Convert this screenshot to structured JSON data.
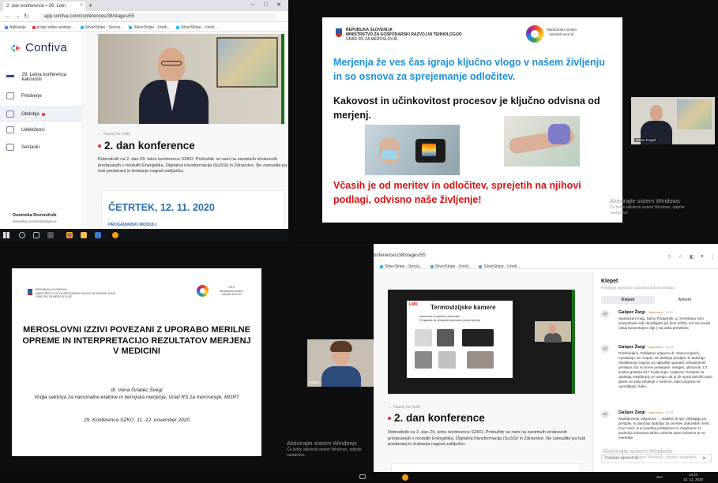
{
  "q1": {
    "browser": {
      "tab_title": "2. dan konference • 29. Letn",
      "tab_close": "×",
      "new_tab": "+",
      "url": "app.confiva.com/conferences/38/stages/55",
      "bookmarks": [
        "Aplikacije",
        "propo video animac...",
        "SilverStripe - Sezna...",
        "SilverStripe - Uredi...",
        "SilverStripe - Uredi..."
      ]
    },
    "sidebar": {
      "logo": "Confiva",
      "items": [
        {
          "label": "29. Letna konferenca kakovosti",
          "icon": "conference-icon"
        },
        {
          "label": "Predverje",
          "icon": "building-icon"
        },
        {
          "label": "Obdobja",
          "icon": "person-icon"
        },
        {
          "label": "Udeleženci",
          "icon": "people-icon"
        },
        {
          "label": "Sestanki",
          "icon": "meeting-icon"
        }
      ],
      "user_name": "Dominika Rozoničnik",
      "user_email": "dominika.rozonicnik@gov.si"
    },
    "content": {
      "back_link": "Nazaj na Sobi",
      "title": "2. dan konference",
      "intro": "Dobrodošli na 2. dan 29. letne konference SZKO. Pridružite se nam na zanimivih strokovnih predavanjih v modulih Energetika, Digitalna transformacija (SuSSi) in Zdravstvo. Ne zamudite pa tudi predavanj in žrebanja nagrad zaključku.",
      "date": "ČETRTEK, 12. 11. 2020",
      "programme": "PROGRAMSKI MODULI"
    }
  },
  "q2": {
    "slide": {
      "header": [
        "REPUBLIKA SLOVENIJA",
        "MINISTRSTVO ZA GOSPODARSKI RAZVOJ IN TEHNOLOGIJO",
        "URAD RS ZA MEROSLOVJE"
      ],
      "logo_text": [
        "Mednarodni sistem",
        "merskih enot SI"
      ],
      "line1": "Merjenja že ves čas igrajo ključno vlogo v našem življenju in so osnova za sprejemanje odločitev.",
      "line2": "Kakovost in učinkovitost procesov je ključno odvisna od merjenj.",
      "line3": "Včasih je od meritev in odločitev, sprejetih na njihovi podlagi, odvisno naše življenje!"
    },
    "pip_name": "Samo Kopač",
    "activate_title": "Aktivirajte sistem Windows",
    "activate_sub": "Če želite aktivirati sistem Windows, odprite nastavitve."
  },
  "q3": {
    "slide": {
      "header": [
        "REPUBLIKA SLOVENIJA",
        "MINISTRSTVO ZA GOSPODARSKI RAZVOJ IN TEHNOLOGIJO",
        "URAD RS ZA MEROSLOVJE"
      ],
      "logo_text": [
        "2019",
        "Mednarodni sistem",
        "merskih enot SI"
      ],
      "title": "MEROSLOVNI IZZIVI POVEZANI Z UPORABO MERILNE OPREME IN INTERPRETACIJO REZULTATOV MERJENJ V MEDICINI",
      "author": "dr. Irena Grabec Švegl",
      "author_role": "Vodja sektorja za nacionalne etalone in kemijska merjenja, Urad RS za meroslovje, MGRT",
      "conference": "29. Konferenca SZKO, 11.-12. november 2020"
    },
    "pip_name": "grabec",
    "activate_title": "Aktivirajte sistem Windows",
    "activate_sub": "Če želite aktivirati sistem Windows, odprite nastavitve."
  },
  "q4": {
    "url": "onferences/38/stages/55",
    "bookmarks": [
      "SilverStripe - Sezna...",
      "SilverStripe - Uredi...",
      "SilverStripe - Uredi..."
    ],
    "mini_slide": {
      "logo": "LMK",
      "title": "Termovizijske kamere",
      "bullets": [
        "Namenske in splošno-namenske",
        "5 Hajaenie ali netrajenie delovanie (velika večina)"
      ]
    },
    "content": {
      "back_link": "Nazaj na Sobi",
      "title": "2. dan konference",
      "intro": "Dobrodošli na 2. dan 29. letne konference SZKO. Pridružite se nam na zanimivih strokovnih predavanjih v modulih Energetika, Digitalna transformacija (SuSSi) in Zdravstvo. Ne zamudite pa tudi predavanj in žrebanja nagrad zaključku."
    },
    "chat": {
      "title": "Klepet",
      "subtitle": "Pošiljanje sporočil in podrobnosti komunikacija",
      "tabs": [
        "Klepet",
        "Ankete"
      ],
      "messages": [
        {
          "initials": "GŽ",
          "name": "Gašper Žargi",
          "role": "Organizator",
          "time": "10:22",
          "text": "Spoštovani mag. Samo Podgornik, g. Smrekarju smo posredovali vaši domišljijski pis (leto 2020), kot ste prosili nekaj komentarjev vlije ) Na vaša preteklost"
        },
        {
          "initials": "GŽ",
          "name": "Gašper Žargi",
          "role": "Organizator",
          "time": "10:24",
          "text": "Pozdravljeni, Pošiljamo odgovor dr. Sama Kopača Vprašanje: Dr. Kopač, ali obdobja predpisi. ki določajo rekalibracijo naprav za najboljše uporabo zdravstvenih preiskav, kot so krvne preiskave, rentgen, ultrazvok, CT, kostna gostota itd.? Hvala lepa. Odgovor: Predpisi za obdobja rekalibracij ne ovirajo, da bi jih moral določiti sami glede na vaša izkušnje z merilom, kako pogosto se uporabljajo, kako..."
        },
        {
          "initials": "GŽ",
          "name": "Gašper Žargi",
          "role": "Organizator",
          "time": "10:28",
          "text": "Nadaljevanje odgovora: ... stabilen je ipd. Obstajajo pa predpisi, ki določajo obdobja za overitev zakonskih meril, to je meril, ki je posebej predpisane in regulirana. Iz področja zdravstva lahko omenite samo tehtnice je na merilnike"
        }
      ],
      "input_placeholder": "Vnesite sporočilo..."
    },
    "clock_time": "14:24",
    "clock_date": "12. 11. 2020",
    "tray_lang": "SLV",
    "activate_title": "Aktivirajte sistem Windows",
    "activate_sub": "Če želite aktivirati sistem Windows, odprite nastavitve."
  }
}
